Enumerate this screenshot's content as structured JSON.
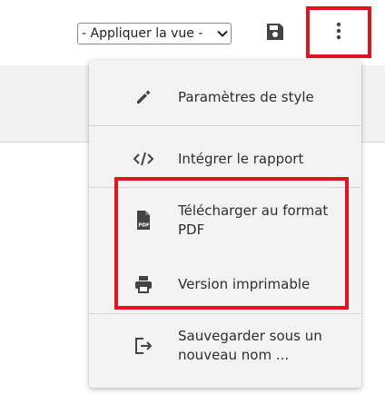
{
  "toolbar": {
    "view_select": {
      "value": "- Appliquer la vue -"
    }
  },
  "menu": {
    "items": [
      {
        "label": "Paramètres de style",
        "icon": "pencil-icon"
      },
      {
        "label": "Intégrer le rapport",
        "icon": "code-icon"
      },
      {
        "label": "Télécharger au format PDF",
        "icon": "pdf-file-icon",
        "icon_text": "PDF"
      },
      {
        "label": "Version imprimable",
        "icon": "printer-icon"
      },
      {
        "label": "Sauvegarder sous un nouveau nom ...",
        "icon": "save-as-icon"
      }
    ]
  },
  "colors": {
    "highlight": "#e0141e",
    "icon": "#444444",
    "menu_background": "#f3f3f3"
  }
}
